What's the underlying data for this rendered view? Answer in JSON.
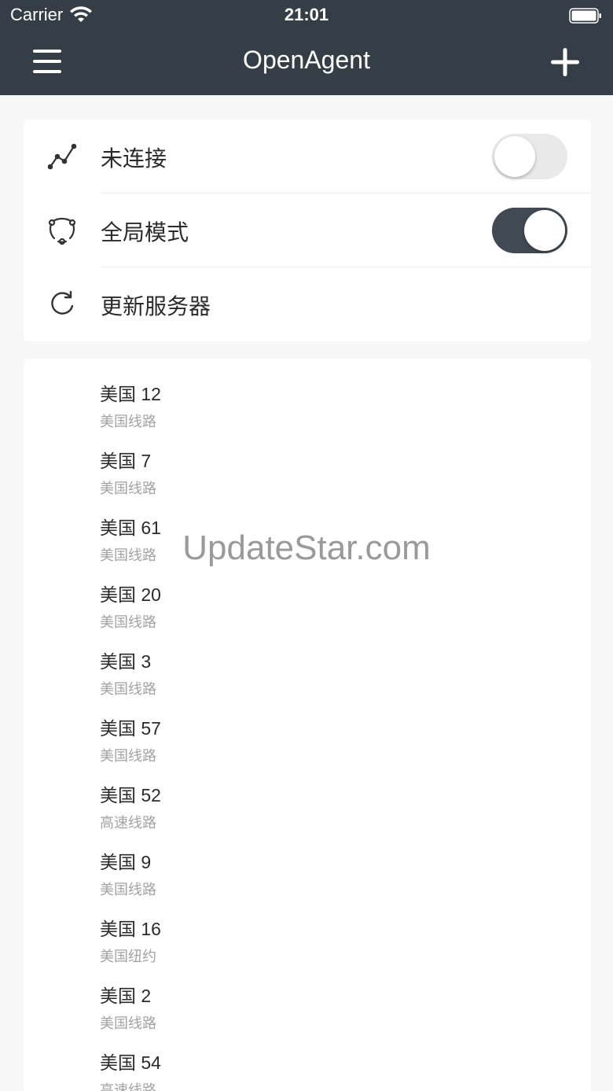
{
  "status_bar": {
    "carrier": "Carrier",
    "time": "21:01"
  },
  "nav": {
    "title": "OpenAgent",
    "menu_icon": "menu-icon",
    "add_icon": "plus-icon"
  },
  "settings": [
    {
      "icon": "chart-line-icon",
      "label": "未连接",
      "toggle": "off"
    },
    {
      "icon": "globe-shield-icon",
      "label": "全局模式",
      "toggle": "on"
    },
    {
      "icon": "refresh-icon",
      "label": "更新服务器"
    }
  ],
  "servers": [
    {
      "name": "美国 12",
      "route": "美国线路"
    },
    {
      "name": "美国 7",
      "route": "美国线路"
    },
    {
      "name": "美国 61",
      "route": "美国线路"
    },
    {
      "name": "美国 20",
      "route": "美国线路"
    },
    {
      "name": "美国 3",
      "route": "美国线路"
    },
    {
      "name": "美国 57",
      "route": "美国线路"
    },
    {
      "name": "美国 52",
      "route": "高速线路"
    },
    {
      "name": "美国 9",
      "route": "美国线路"
    },
    {
      "name": "美国 16",
      "route": "美国纽约"
    },
    {
      "name": "美国 2",
      "route": "美国线路"
    },
    {
      "name": "美国 54",
      "route": "高速线路"
    }
  ],
  "watermark": "UpdateStar.com",
  "colors": {
    "header": "#353e46",
    "toggle_on": "#414a52",
    "toggle_off": "#e9e9ea"
  }
}
